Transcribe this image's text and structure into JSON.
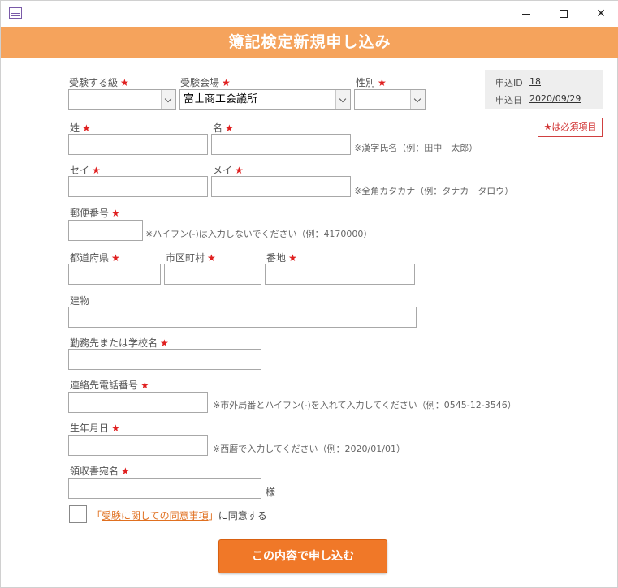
{
  "window": {
    "min_glyph": "",
    "close_glyph": "✕"
  },
  "header": {
    "title": "簿記検定新規申し込み"
  },
  "info": {
    "id_label": "申込ID",
    "id_value": "18",
    "date_label": "申込日",
    "date_value": "2020/09/29"
  },
  "required_note": "★は必須項目",
  "star": "★",
  "fields": {
    "grade": {
      "label": "受験する級",
      "value": ""
    },
    "venue": {
      "label": "受験会場",
      "value": "富士商工会議所"
    },
    "gender": {
      "label": "性別",
      "value": ""
    },
    "last_name": {
      "label": "姓",
      "value": ""
    },
    "first_name": {
      "label": "名",
      "value": ""
    },
    "name_note": "※漢字氏名（例：田中　太郎）",
    "last_kana": {
      "label": "セイ",
      "value": ""
    },
    "first_kana": {
      "label": "メイ",
      "value": ""
    },
    "kana_note": "※全角カタカナ（例：タナカ　タロウ）",
    "postal": {
      "label": "郵便番号",
      "value": ""
    },
    "postal_note": "※ハイフン(-)は入力しないでください（例：4170000）",
    "prefecture": {
      "label": "都道府県",
      "value": ""
    },
    "city": {
      "label": "市区町村",
      "value": ""
    },
    "street": {
      "label": "番地",
      "value": ""
    },
    "building": {
      "label": "建物",
      "value": ""
    },
    "workplace": {
      "label": "勤務先または学校名",
      "value": ""
    },
    "phone": {
      "label": "連絡先電話番号",
      "value": ""
    },
    "phone_note": "※市外局番とハイフン(-)を入れて入力してください（例：0545-12-3546）",
    "birthdate": {
      "label": "生年月日",
      "value": ""
    },
    "birthdate_note": "※西暦で入力してください（例：2020/01/01）",
    "receipt": {
      "label": "領収書宛名",
      "value": ""
    },
    "receipt_suffix": "様"
  },
  "agreement": {
    "open_bracket": "「",
    "link": "受験に関しての同意事項",
    "close_bracket": "」",
    "text": "に同意する"
  },
  "submit_label": "この内容で申し込む"
}
